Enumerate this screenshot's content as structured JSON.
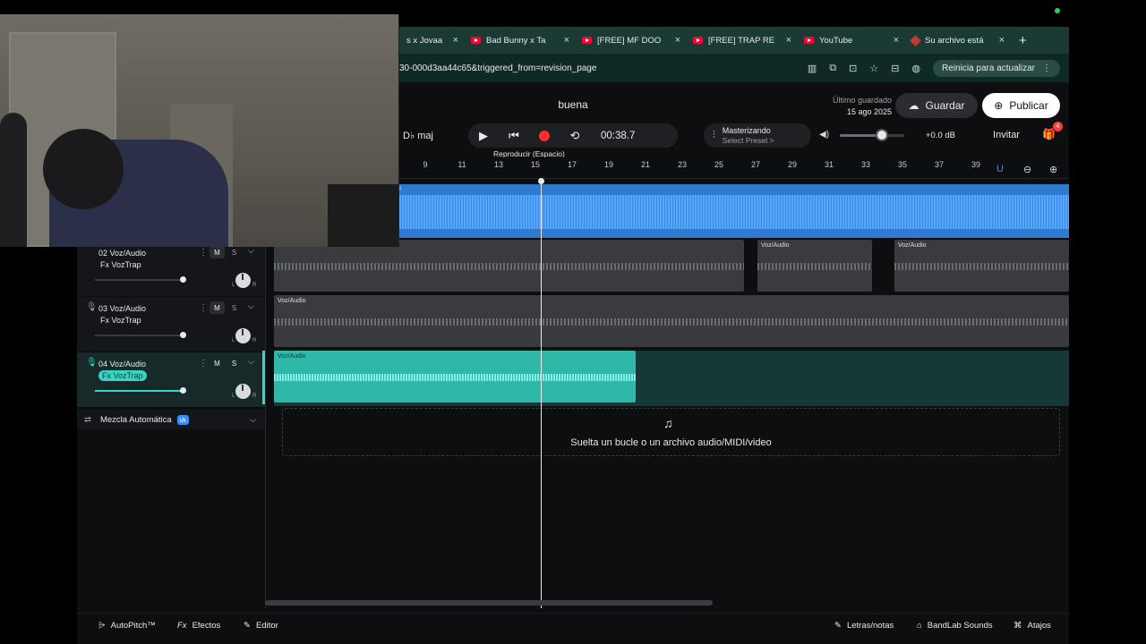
{
  "browser": {
    "tabs": [
      {
        "label": "s x Jovaa",
        "icon": "youtube-icon"
      },
      {
        "label": "Bad Bunny x Ta",
        "icon": "youtube-icon"
      },
      {
        "label": "[FREE] MF DOO",
        "icon": "youtube-icon"
      },
      {
        "label": "[FREE] TRAP RE",
        "icon": "youtube-icon"
      },
      {
        "label": "YouTube",
        "icon": "youtube-icon"
      },
      {
        "label": "Su archivo está",
        "icon": "document-icon"
      }
    ],
    "new_tab": "+",
    "close_glyph": "×",
    "url": "30-000d3aa44c65&triggered_from=revision_page",
    "update_label": "Reinicia para actualizar"
  },
  "app": {
    "project_title": "buena",
    "saved_label": "Último guardado",
    "saved_date": "15 ago 2025",
    "save_button": "Guardar",
    "publish_button": "Publicar",
    "key": "D♭ maj",
    "time": "00:38.7",
    "tooltip": "Reproducir (Espacio)",
    "mastering_title": "Masterizando",
    "mastering_preset": "Select Preset >",
    "volume_db": "+0.0 dB",
    "volume_level": 0.65,
    "invite_button": "Invitar",
    "gift_badge": "4",
    "accent": "#35d7c4"
  },
  "ruler": {
    "ticks": [
      "9",
      "11",
      "13",
      "15",
      "17",
      "19",
      "21",
      "23",
      "25",
      "27",
      "29",
      "31",
      "33",
      "35",
      "37",
      "39"
    ]
  },
  "tracks": [
    {
      "name": "02  Voz/Audio",
      "fx": "Fx VozTrap",
      "mute": "M",
      "solo": "S",
      "L": "L",
      "R": "R"
    },
    {
      "name": "03  Voz/Audio",
      "fx": "Fx VozTrap",
      "mute": "M",
      "solo": "S",
      "L": "L",
      "R": "R"
    },
    {
      "name": "04  Voz/Audio",
      "fx": "Fx VozTrap",
      "mute": "M",
      "solo": "S",
      "L": "L",
      "R": "R"
    }
  ],
  "clips": {
    "label": "Voz/Audio",
    "lane1_label": "I"
  },
  "automix": {
    "label": "Mezcla Automática",
    "badge": "IA"
  },
  "drop_zone": "Suelta un bucle o un archivo audio/MIDI/video",
  "bottom": {
    "autopitch": "AutoPitch™",
    "effects": "Efectos",
    "editor": "Editor",
    "lyrics": "Letras/notas",
    "sounds": "BandLab Sounds",
    "shortcuts": "Atajos"
  }
}
